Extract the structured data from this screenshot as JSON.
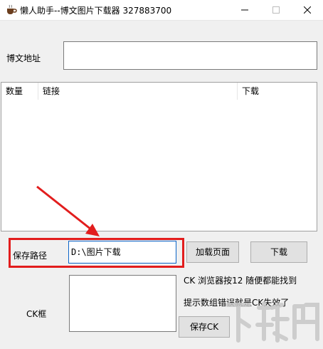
{
  "window": {
    "title": "懒人助手--博文图片下载器  327883700"
  },
  "form": {
    "url_label": "博文地址",
    "url_value": "",
    "save_path_label": "保存路径",
    "save_path_value": "D:\\图片下载",
    "ck_label": "CK框",
    "ck_value": "",
    "hint1": "CK 浏览器按12 随便都能找到",
    "hint2": "提示数组错误就是CK失效了"
  },
  "list": {
    "columns": [
      "数量",
      "链接",
      "下载"
    ],
    "rows": []
  },
  "buttons": {
    "load": "加载页面",
    "download": "下载",
    "save_ck": "保存CK"
  },
  "colors": {
    "highlight_red": "#e21d1d",
    "focus_blue": "#0a64c8"
  },
  "icons": {
    "app": "coffee-cup-icon",
    "minimize": "minimize-icon",
    "maximize": "maximize-icon",
    "close": "close-icon"
  },
  "watermark": {
    "text": "下载吧"
  }
}
